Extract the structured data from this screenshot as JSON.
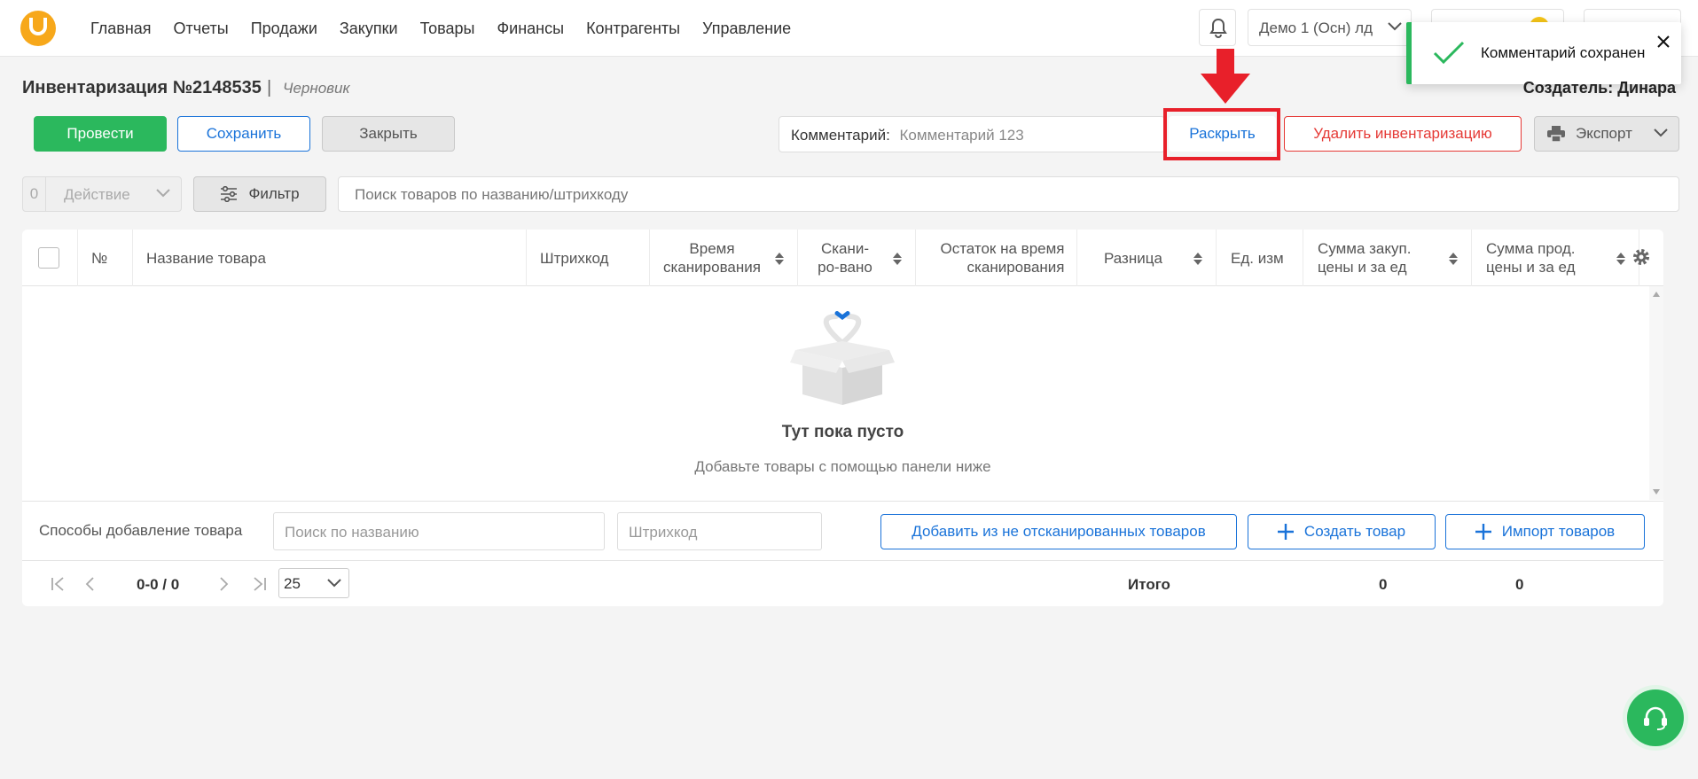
{
  "nav": {
    "items": [
      "Главная",
      "Отчеты",
      "Продажи",
      "Закупки",
      "Товары",
      "Финансы",
      "Контрагенты",
      "Управление"
    ],
    "org": "Демо 1 (Осн) лд"
  },
  "toast": {
    "message": "Комментарий сохранен"
  },
  "header": {
    "title": "Инвентаризация №2148535",
    "separator": "|",
    "status": "Черновик",
    "creator": "Создатель: Динара"
  },
  "actions": {
    "conduct": "Провести",
    "save": "Сохранить",
    "close": "Закрыть",
    "comment_label": "Комментарий:",
    "comment_value": "Комментарий 123",
    "expand": "Раскрыть",
    "delete": "Удалить инвентаризацию",
    "export": "Экспорт"
  },
  "toolbar": {
    "selected_count": "0",
    "action": "Действие",
    "filter": "Фильтр",
    "search_placeholder": "Поиск товаров по названию/штрихкоду"
  },
  "table": {
    "columns": {
      "num": "№",
      "name": "Название товара",
      "barcode": "Штрихкод",
      "scan_time": "Время сканирования",
      "scanned": "Скани-ро-вано",
      "stock": "Остаток на время сканирования",
      "diff": "Разница",
      "unit": "Ед. изм",
      "purchase_sum": "Сумма закуп. цены и за ед",
      "sale_sum": "Сумма прод. цены и за ед"
    },
    "empty_title": "Тут пока пусто",
    "empty_subtitle": "Добавьте товары с помощью панели ниже"
  },
  "add_panel": {
    "label": "Способы добавление товара",
    "name_placeholder": "Поиск по названию",
    "barcode_placeholder": "Штрихкод",
    "add_unscanned": "Добавить из не отсканированных товаров",
    "create_product": "Создать товар",
    "import_products": "Импорт товаров"
  },
  "pager": {
    "range": "0-0 / 0",
    "page_size": "25",
    "total_label": "Итого",
    "total_purchase": "0",
    "total_sale": "0"
  },
  "colors": {
    "accent_green": "#2bb85d",
    "accent_blue": "#1a73d9",
    "danger_red": "#e53935",
    "brand_orange": "#f7a81b",
    "highlight_red": "#e8202a"
  },
  "icons": [
    "logo-icon",
    "bell-icon",
    "chevron-down-icon",
    "check-icon",
    "close-icon",
    "printer-icon",
    "filter-icon",
    "sort-icon",
    "gear-icon",
    "empty-box-icon",
    "plus-icon",
    "first-page-icon",
    "prev-page-icon",
    "next-page-icon",
    "last-page-icon",
    "headset-icon",
    "arrow-down-icon"
  ]
}
